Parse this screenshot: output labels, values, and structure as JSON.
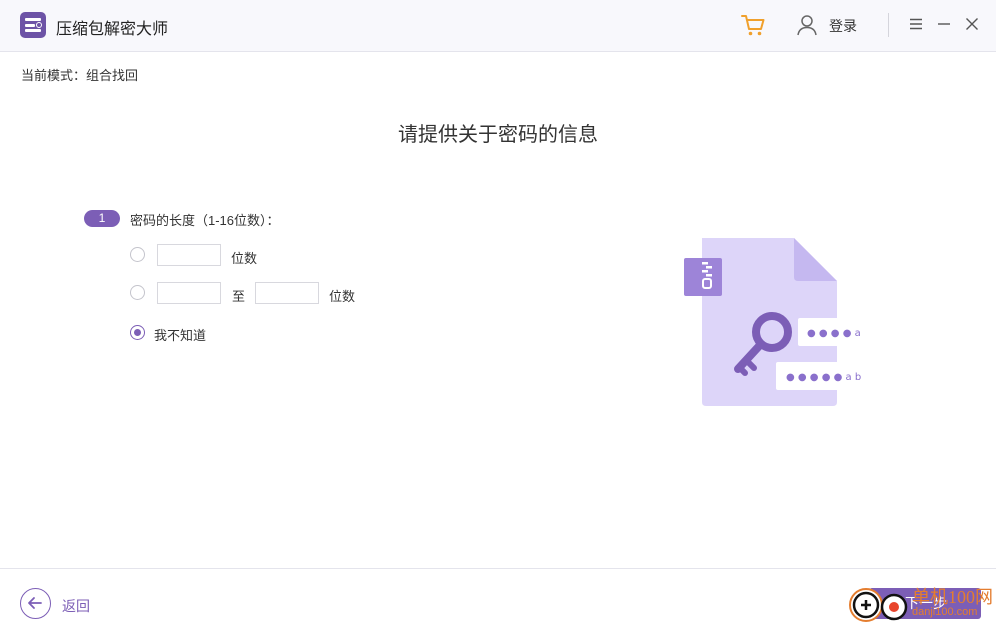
{
  "app": {
    "title": "压缩包解密大师"
  },
  "header": {
    "login_label": "登录"
  },
  "mode": {
    "text": "当前模式：组合找回"
  },
  "page": {
    "heading": "请提供关于密码的信息"
  },
  "step": {
    "number": "1",
    "label": "密码的长度（1-16位数）：",
    "options": [
      {
        "unit_label": "位数",
        "value": "",
        "selected": false
      },
      {
        "to_label": "至",
        "unit_label": "位数",
        "from_value": "",
        "to_value": "",
        "selected": false
      },
      {
        "label": "我不知道",
        "selected": true
      }
    ]
  },
  "illustration": {
    "password_row_1": "● ● ● ● a",
    "password_row_2": "● ● ● ● ● a b"
  },
  "footer": {
    "back_label": "返回",
    "next_label": "下一步"
  },
  "watermark": {
    "top_text": "单机100网",
    "bottom_text": "danji100.com"
  },
  "colors": {
    "accent": "#7c5eb6",
    "logo": "#6d53a6",
    "cart": "#f0a02c",
    "illustration_bg": "#ddd5f9",
    "illustration_fold": "#c5b8f0",
    "watermark": "#e47d2f"
  }
}
